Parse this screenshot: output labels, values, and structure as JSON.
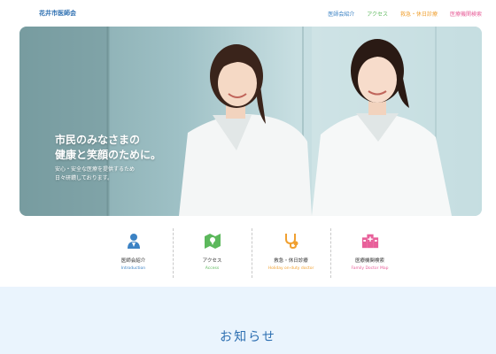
{
  "header": {
    "logo": "花井市医師会",
    "nav": [
      {
        "label": "医師会紹介",
        "color": "#3b82c4"
      },
      {
        "label": "アクセス",
        "color": "#5cb85c"
      },
      {
        "label": "救急・休日診療",
        "color": "#f0a030"
      },
      {
        "label": "医療機関検索",
        "color": "#e8609a"
      }
    ]
  },
  "hero": {
    "title_line1": "市民のみなさまの",
    "title_line2": "健康と笑顔のために。",
    "sub_line1": "安心・安全な医療を提供するため",
    "sub_line2": "日々研鑽しております。"
  },
  "tiles": [
    {
      "label": "医師会紹介",
      "en": "Introduction",
      "icon": "doctor-icon",
      "color": "#3b82c4"
    },
    {
      "label": "アクセス",
      "en": "Access",
      "icon": "map-icon",
      "color": "#5cb85c"
    },
    {
      "label": "救急・休日診療",
      "en": "Holiday on-duty doctor",
      "icon": "stethoscope-icon",
      "color": "#f0a030"
    },
    {
      "label": "医療機関検索",
      "en": "Family Doctor Map",
      "icon": "hospital-icon",
      "color": "#e8609a"
    }
  ],
  "news": {
    "title": "お知らせ"
  }
}
